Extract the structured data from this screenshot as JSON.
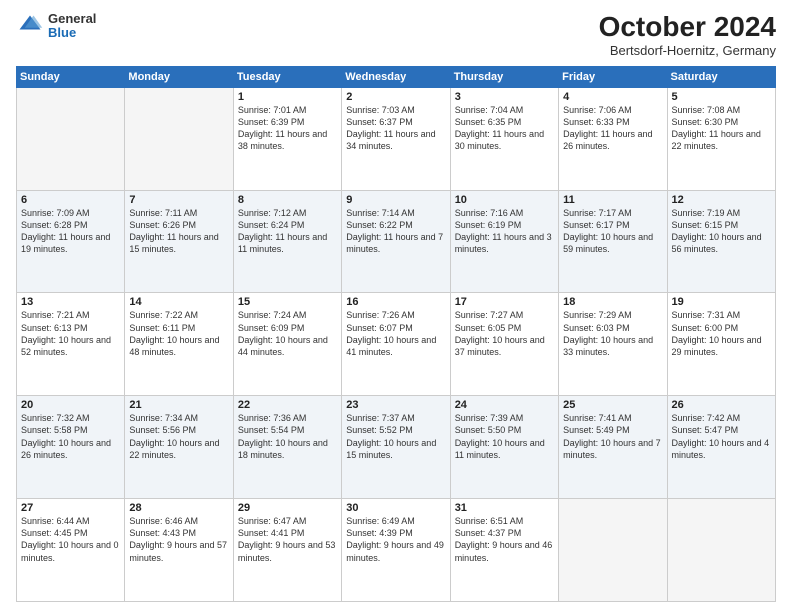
{
  "header": {
    "logo": {
      "general": "General",
      "blue": "Blue"
    },
    "title": "October 2024",
    "subtitle": "Bertsdorf-Hoernitz, Germany"
  },
  "weekdays": [
    "Sunday",
    "Monday",
    "Tuesday",
    "Wednesday",
    "Thursday",
    "Friday",
    "Saturday"
  ],
  "weeks": [
    [
      {
        "day": "",
        "sunrise": "",
        "sunset": "",
        "daylight": ""
      },
      {
        "day": "",
        "sunrise": "",
        "sunset": "",
        "daylight": ""
      },
      {
        "day": "1",
        "sunrise": "Sunrise: 7:01 AM",
        "sunset": "Sunset: 6:39 PM",
        "daylight": "Daylight: 11 hours and 38 minutes."
      },
      {
        "day": "2",
        "sunrise": "Sunrise: 7:03 AM",
        "sunset": "Sunset: 6:37 PM",
        "daylight": "Daylight: 11 hours and 34 minutes."
      },
      {
        "day": "3",
        "sunrise": "Sunrise: 7:04 AM",
        "sunset": "Sunset: 6:35 PM",
        "daylight": "Daylight: 11 hours and 30 minutes."
      },
      {
        "day": "4",
        "sunrise": "Sunrise: 7:06 AM",
        "sunset": "Sunset: 6:33 PM",
        "daylight": "Daylight: 11 hours and 26 minutes."
      },
      {
        "day": "5",
        "sunrise": "Sunrise: 7:08 AM",
        "sunset": "Sunset: 6:30 PM",
        "daylight": "Daylight: 11 hours and 22 minutes."
      }
    ],
    [
      {
        "day": "6",
        "sunrise": "Sunrise: 7:09 AM",
        "sunset": "Sunset: 6:28 PM",
        "daylight": "Daylight: 11 hours and 19 minutes."
      },
      {
        "day": "7",
        "sunrise": "Sunrise: 7:11 AM",
        "sunset": "Sunset: 6:26 PM",
        "daylight": "Daylight: 11 hours and 15 minutes."
      },
      {
        "day": "8",
        "sunrise": "Sunrise: 7:12 AM",
        "sunset": "Sunset: 6:24 PM",
        "daylight": "Daylight: 11 hours and 11 minutes."
      },
      {
        "day": "9",
        "sunrise": "Sunrise: 7:14 AM",
        "sunset": "Sunset: 6:22 PM",
        "daylight": "Daylight: 11 hours and 7 minutes."
      },
      {
        "day": "10",
        "sunrise": "Sunrise: 7:16 AM",
        "sunset": "Sunset: 6:19 PM",
        "daylight": "Daylight: 11 hours and 3 minutes."
      },
      {
        "day": "11",
        "sunrise": "Sunrise: 7:17 AM",
        "sunset": "Sunset: 6:17 PM",
        "daylight": "Daylight: 10 hours and 59 minutes."
      },
      {
        "day": "12",
        "sunrise": "Sunrise: 7:19 AM",
        "sunset": "Sunset: 6:15 PM",
        "daylight": "Daylight: 10 hours and 56 minutes."
      }
    ],
    [
      {
        "day": "13",
        "sunrise": "Sunrise: 7:21 AM",
        "sunset": "Sunset: 6:13 PM",
        "daylight": "Daylight: 10 hours and 52 minutes."
      },
      {
        "day": "14",
        "sunrise": "Sunrise: 7:22 AM",
        "sunset": "Sunset: 6:11 PM",
        "daylight": "Daylight: 10 hours and 48 minutes."
      },
      {
        "day": "15",
        "sunrise": "Sunrise: 7:24 AM",
        "sunset": "Sunset: 6:09 PM",
        "daylight": "Daylight: 10 hours and 44 minutes."
      },
      {
        "day": "16",
        "sunrise": "Sunrise: 7:26 AM",
        "sunset": "Sunset: 6:07 PM",
        "daylight": "Daylight: 10 hours and 41 minutes."
      },
      {
        "day": "17",
        "sunrise": "Sunrise: 7:27 AM",
        "sunset": "Sunset: 6:05 PM",
        "daylight": "Daylight: 10 hours and 37 minutes."
      },
      {
        "day": "18",
        "sunrise": "Sunrise: 7:29 AM",
        "sunset": "Sunset: 6:03 PM",
        "daylight": "Daylight: 10 hours and 33 minutes."
      },
      {
        "day": "19",
        "sunrise": "Sunrise: 7:31 AM",
        "sunset": "Sunset: 6:00 PM",
        "daylight": "Daylight: 10 hours and 29 minutes."
      }
    ],
    [
      {
        "day": "20",
        "sunrise": "Sunrise: 7:32 AM",
        "sunset": "Sunset: 5:58 PM",
        "daylight": "Daylight: 10 hours and 26 minutes."
      },
      {
        "day": "21",
        "sunrise": "Sunrise: 7:34 AM",
        "sunset": "Sunset: 5:56 PM",
        "daylight": "Daylight: 10 hours and 22 minutes."
      },
      {
        "day": "22",
        "sunrise": "Sunrise: 7:36 AM",
        "sunset": "Sunset: 5:54 PM",
        "daylight": "Daylight: 10 hours and 18 minutes."
      },
      {
        "day": "23",
        "sunrise": "Sunrise: 7:37 AM",
        "sunset": "Sunset: 5:52 PM",
        "daylight": "Daylight: 10 hours and 15 minutes."
      },
      {
        "day": "24",
        "sunrise": "Sunrise: 7:39 AM",
        "sunset": "Sunset: 5:50 PM",
        "daylight": "Daylight: 10 hours and 11 minutes."
      },
      {
        "day": "25",
        "sunrise": "Sunrise: 7:41 AM",
        "sunset": "Sunset: 5:49 PM",
        "daylight": "Daylight: 10 hours and 7 minutes."
      },
      {
        "day": "26",
        "sunrise": "Sunrise: 7:42 AM",
        "sunset": "Sunset: 5:47 PM",
        "daylight": "Daylight: 10 hours and 4 minutes."
      }
    ],
    [
      {
        "day": "27",
        "sunrise": "Sunrise: 6:44 AM",
        "sunset": "Sunset: 4:45 PM",
        "daylight": "Daylight: 10 hours and 0 minutes."
      },
      {
        "day": "28",
        "sunrise": "Sunrise: 6:46 AM",
        "sunset": "Sunset: 4:43 PM",
        "daylight": "Daylight: 9 hours and 57 minutes."
      },
      {
        "day": "29",
        "sunrise": "Sunrise: 6:47 AM",
        "sunset": "Sunset: 4:41 PM",
        "daylight": "Daylight: 9 hours and 53 minutes."
      },
      {
        "day": "30",
        "sunrise": "Sunrise: 6:49 AM",
        "sunset": "Sunset: 4:39 PM",
        "daylight": "Daylight: 9 hours and 49 minutes."
      },
      {
        "day": "31",
        "sunrise": "Sunrise: 6:51 AM",
        "sunset": "Sunset: 4:37 PM",
        "daylight": "Daylight: 9 hours and 46 minutes."
      },
      {
        "day": "",
        "sunrise": "",
        "sunset": "",
        "daylight": ""
      },
      {
        "day": "",
        "sunrise": "",
        "sunset": "",
        "daylight": ""
      }
    ]
  ]
}
